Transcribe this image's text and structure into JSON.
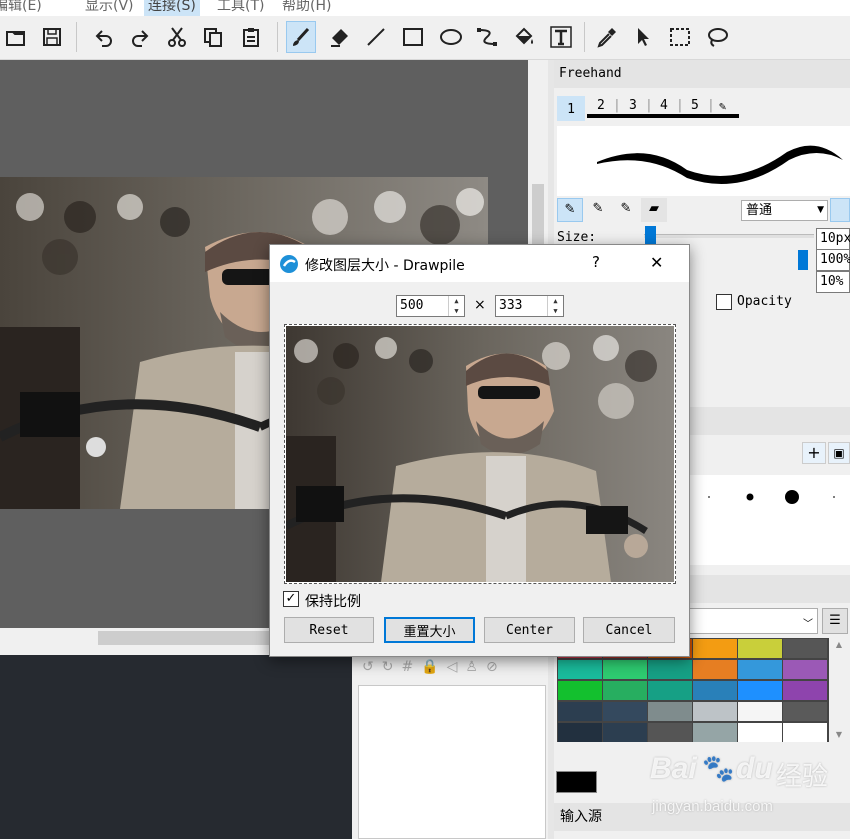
{
  "menu": {
    "items": [
      "编辑(E)",
      "显示(V)",
      "连接(S)",
      "工具(T)",
      "帮助(H)"
    ],
    "active": "连接(S)"
  },
  "toolbar": {
    "icons": [
      "open-icon",
      "save-icon",
      "undo-icon",
      "redo-icon",
      "cut-icon",
      "copy-icon",
      "paste-icon",
      "freehand-brush-icon",
      "eraser-icon",
      "line-icon",
      "rectangle-icon",
      "ellipse-icon",
      "bezier-icon",
      "fill-bucket-icon",
      "text-icon",
      "color-picker-icon",
      "move-pointer-icon",
      "rect-select-icon",
      "lasso-select-icon"
    ],
    "active": "freehand-brush-icon"
  },
  "brush_panel": {
    "title": "Freehand",
    "slots": [
      "1",
      "2",
      "3",
      "4",
      "5"
    ],
    "active_slot": "1",
    "blend_mode": "普通",
    "size_label": "Size:",
    "size_value": "10px",
    "opacity_value": "100%",
    "hardness_value": "10%",
    "opacity_checkbox": "Opacity",
    "opacity_checked": false
  },
  "palette_panel": {
    "colors": [
      [
        "#c9364a",
        "#b0302a",
        "#d35400",
        "#f39c12",
        "#c9cf3a",
        "#565656"
      ],
      [
        "#1abc9c",
        "#2ecc71",
        "#16a085",
        "#e67e22",
        "#3498db",
        "#9b59b6"
      ],
      [
        "#13c02e",
        "#27ae60",
        "#16a085",
        "#2980b9",
        "#1e90ff",
        "#8e44ad"
      ],
      [
        "#2c3e50",
        "#34495e",
        "#7f8c8d",
        "#bdc3c7",
        "#f5f5f5",
        "#5a5a5a"
      ],
      [
        "#22303f",
        "#2c3e50",
        "#555555",
        "#95a5a6",
        "#ffffff",
        "#ffffff"
      ]
    ],
    "foreground_color": "#000000",
    "input_label": "输入源"
  },
  "dialog": {
    "title": "修改图层大小 - Drawpile",
    "help": "?",
    "close": "✕",
    "width": "500",
    "height": "333",
    "times": "×",
    "keep_aspect": "保持比例",
    "keep_aspect_checked": true,
    "buttons": {
      "reset": "Reset",
      "resize": "重置大小",
      "center": "Center",
      "cancel": "Cancel"
    }
  },
  "watermark": {
    "brand": "Bai",
    "brand2": "du",
    "cn": "经验",
    "url": "jingyan.baidu.com"
  }
}
